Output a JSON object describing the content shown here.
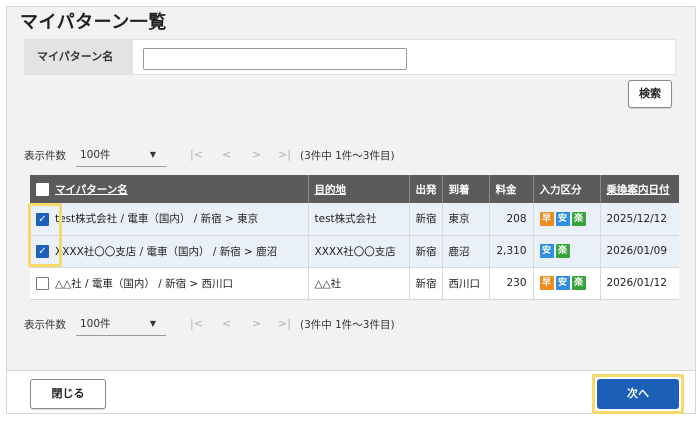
{
  "page": {
    "title": "マイパターン一覧"
  },
  "search": {
    "label": "マイパターン名",
    "value": "",
    "placeholder": "",
    "button": "検索"
  },
  "pager": {
    "per_page_label": "表示件数",
    "per_page_value": "100件",
    "first": "|<",
    "prev": "<",
    "next": ">",
    "last": ">|",
    "count_text": "(3件中 1件～3件目)"
  },
  "table": {
    "columns": [
      "マイパターン名",
      "目的地",
      "出発",
      "到着",
      "料金",
      "入力区分",
      "乗換案内日付"
    ],
    "rows": [
      {
        "checked": true,
        "name": "test株式会社 / 電車（国内） / 新宿 > 東京",
        "destination": "test株式会社",
        "departure": "新宿",
        "arrival": "東京",
        "fare": "208",
        "badges": [
          "早",
          "安",
          "楽"
        ],
        "date": "2025/12/12"
      },
      {
        "checked": true,
        "name": "XXXX社〇〇支店 / 電車（国内） / 新宿 > 鹿沼",
        "destination": "XXXX社〇〇支店",
        "departure": "新宿",
        "arrival": "鹿沼",
        "fare": "2,310",
        "badges": [
          "安",
          "楽"
        ],
        "date": "2026/01/09"
      },
      {
        "checked": false,
        "name": "△△社 / 電車（国内） / 新宿 > 西川口",
        "destination": "△△社",
        "departure": "新宿",
        "arrival": "西川口",
        "fare": "230",
        "badges": [
          "早",
          "安",
          "楽"
        ],
        "date": "2026/01/12"
      }
    ]
  },
  "badge_colors": {
    "早": "#f08a1c",
    "安": "#2f8ee0",
    "楽": "#3aa33a"
  },
  "footer": {
    "close_label": "閉じる",
    "next_label": "次へ"
  },
  "colors": {
    "primary": "#1b5fb8",
    "header_bg": "#5b5b5b",
    "highlight": "#f5d96b",
    "selected_row": "#eaf0f8"
  }
}
